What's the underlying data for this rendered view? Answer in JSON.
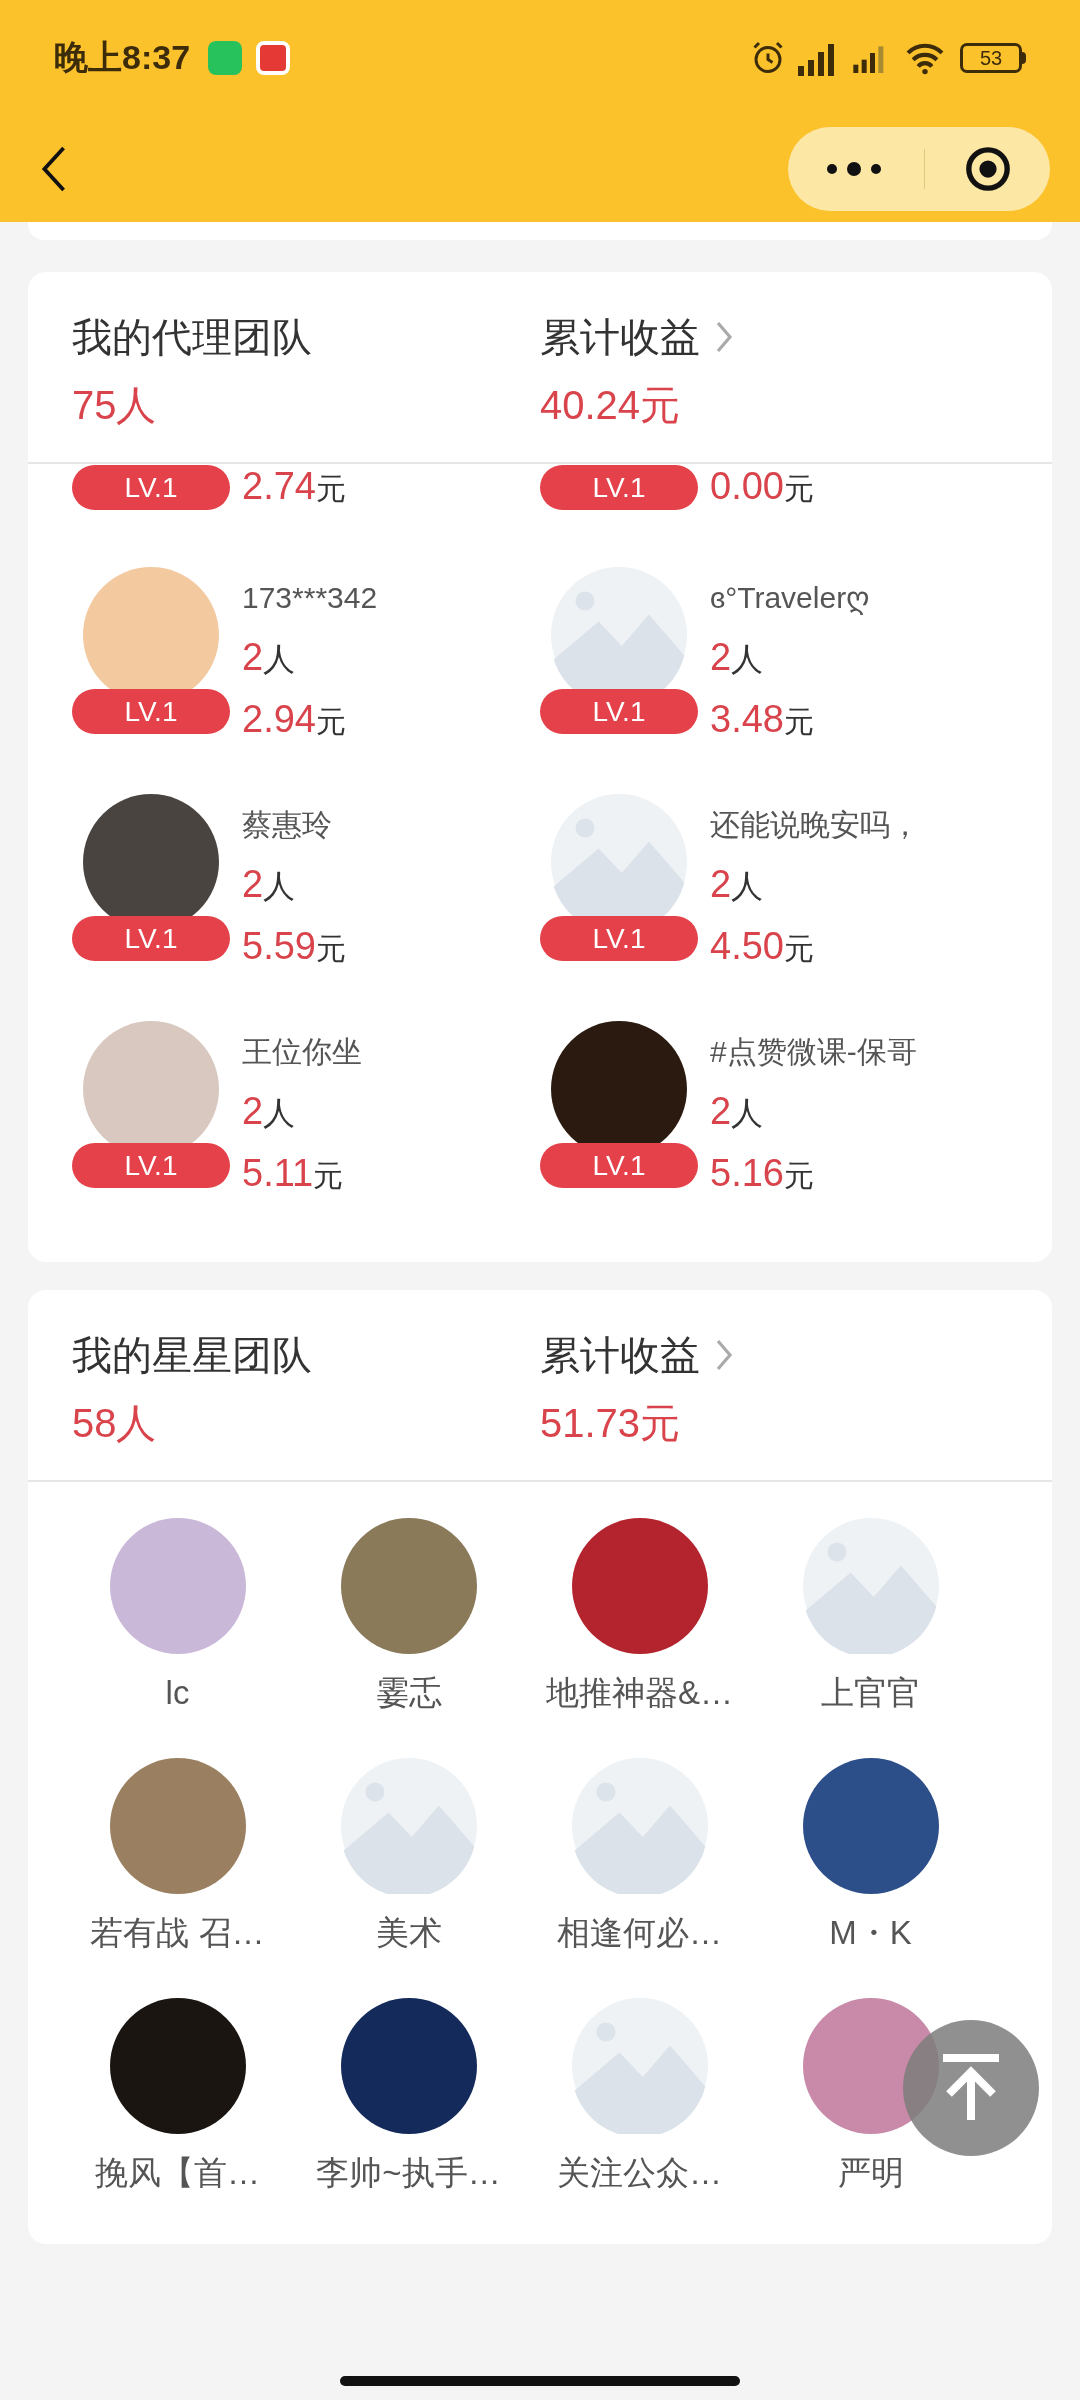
{
  "status_bar": {
    "time": "晚上8:37",
    "battery": "53"
  },
  "agent_team": {
    "title": "我的代理团队",
    "count": "75人",
    "earnings_label": "累计收益",
    "earnings": "40.24元",
    "partial_row": [
      {
        "level_badge": "LV.1",
        "amount": "2.74",
        "unit": "元"
      },
      {
        "level_badge": "LV.1",
        "amount": "0.00",
        "unit": "元"
      }
    ],
    "members": [
      {
        "name": "173***342",
        "kind": "photo",
        "color": "#f3c9a0",
        "people": "2",
        "people_unit": "人",
        "level_badge": "LV.1",
        "amount": "2.94",
        "unit": "元"
      },
      {
        "name": "ɞ°Travelerღ",
        "kind": "placeholder",
        "people": "2",
        "people_unit": "人",
        "level_badge": "LV.1",
        "amount": "3.48",
        "unit": "元"
      },
      {
        "name": "蔡惠玲",
        "kind": "photo",
        "color": "#4a4440",
        "people": "2",
        "people_unit": "人",
        "level_badge": "LV.1",
        "amount": "5.59",
        "unit": "元"
      },
      {
        "name": "还能说晚安吗，",
        "kind": "placeholder",
        "people": "2",
        "people_unit": "人",
        "level_badge": "LV.1",
        "amount": "4.50",
        "unit": "元"
      },
      {
        "name": "王位你坐",
        "kind": "photo",
        "color": "#d9c8c0",
        "people": "2",
        "people_unit": "人",
        "level_badge": "LV.1",
        "amount": "5.11",
        "unit": "元"
      },
      {
        "name": "#点赞微课-保哥",
        "kind": "photo",
        "color": "#2a1a10",
        "people": "2",
        "people_unit": "人",
        "level_badge": "LV.1",
        "amount": "5.16",
        "unit": "元"
      }
    ]
  },
  "star_team": {
    "title": "我的星星团队",
    "count": "58人",
    "earnings_label": "累计收益",
    "earnings": "51.73元",
    "members": [
      {
        "name": "lc",
        "kind": "photo",
        "color": "#c9b8d8"
      },
      {
        "name": "霎忎",
        "kind": "photo",
        "color": "#8a7a5a"
      },
      {
        "name": "地推神器&…",
        "kind": "photo",
        "color": "#b3242f"
      },
      {
        "name": "上官官",
        "kind": "placeholder"
      },
      {
        "name": "若有战 召…",
        "kind": "photo",
        "color": "#9a8060"
      },
      {
        "name": "美术",
        "kind": "placeholder"
      },
      {
        "name": "相逢何必…",
        "kind": "placeholder"
      },
      {
        "name": "M・K",
        "kind": "photo",
        "color": "#2c4f8a"
      },
      {
        "name": "挽风【首…",
        "kind": "photo",
        "color": "#1a1510"
      },
      {
        "name": "李帅~执手…",
        "kind": "photo",
        "color": "#132a5a"
      },
      {
        "name": "关注公众…",
        "kind": "placeholder"
      },
      {
        "name": "严明",
        "kind": "photo",
        "color": "#c88aa8"
      }
    ]
  }
}
